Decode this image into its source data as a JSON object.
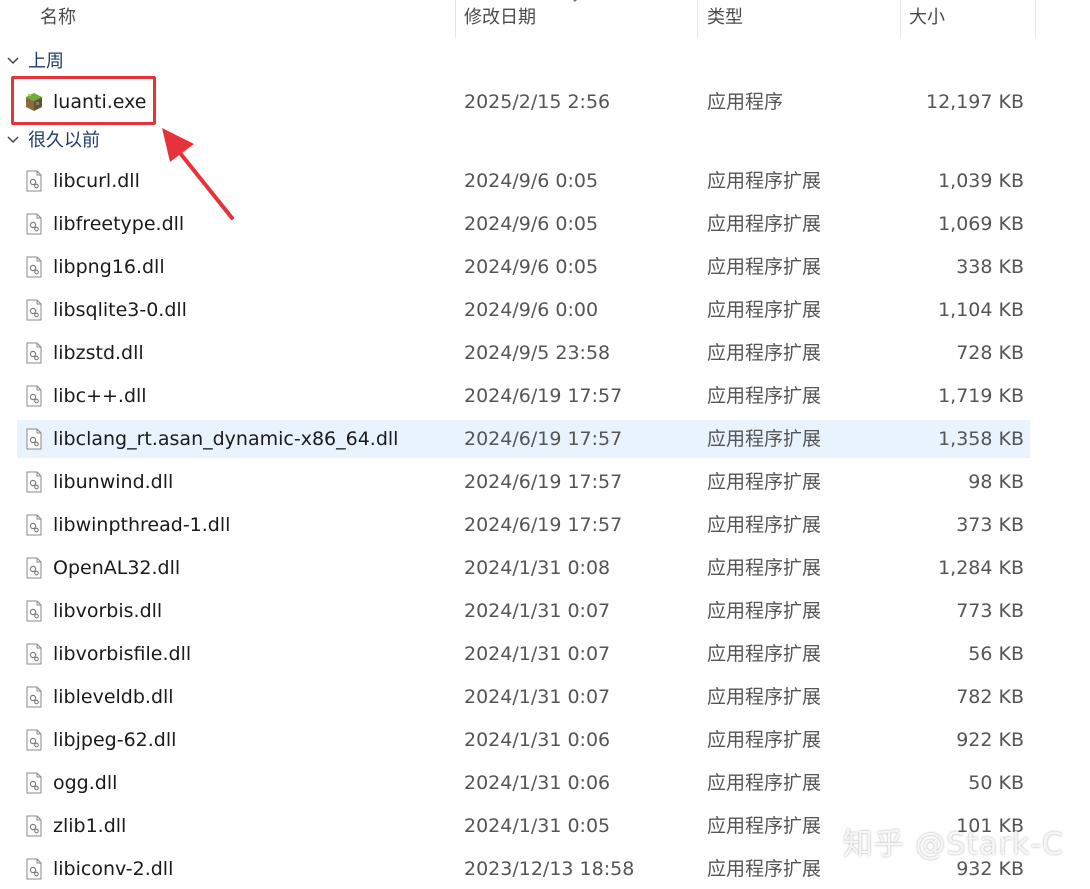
{
  "columns": {
    "name": "名称",
    "date": "修改日期",
    "type": "类型",
    "size": "大小"
  },
  "groups": [
    {
      "label": "上周",
      "files": [
        {
          "name": "luanti.exe",
          "date": "2025/2/15 2:56",
          "type": "应用程序",
          "size": "12,197 KB",
          "icon": "exe-app-icon"
        }
      ]
    },
    {
      "label": "很久以前",
      "files": [
        {
          "name": "libcurl.dll",
          "date": "2024/9/6 0:05",
          "type": "应用程序扩展",
          "size": "1,039 KB",
          "icon": "dll-file-icon"
        },
        {
          "name": "libfreetype.dll",
          "date": "2024/9/6 0:05",
          "type": "应用程序扩展",
          "size": "1,069 KB",
          "icon": "dll-file-icon"
        },
        {
          "name": "libpng16.dll",
          "date": "2024/9/6 0:05",
          "type": "应用程序扩展",
          "size": "338 KB",
          "icon": "dll-file-icon"
        },
        {
          "name": "libsqlite3-0.dll",
          "date": "2024/9/6 0:00",
          "type": "应用程序扩展",
          "size": "1,104 KB",
          "icon": "dll-file-icon"
        },
        {
          "name": "libzstd.dll",
          "date": "2024/9/5 23:58",
          "type": "应用程序扩展",
          "size": "728 KB",
          "icon": "dll-file-icon"
        },
        {
          "name": "libc++.dll",
          "date": "2024/6/19 17:57",
          "type": "应用程序扩展",
          "size": "1,719 KB",
          "icon": "dll-file-icon"
        },
        {
          "name": "libclang_rt.asan_dynamic-x86_64.dll",
          "date": "2024/6/19 17:57",
          "type": "应用程序扩展",
          "size": "1,358 KB",
          "icon": "dll-file-icon",
          "selected": true
        },
        {
          "name": "libunwind.dll",
          "date": "2024/6/19 17:57",
          "type": "应用程序扩展",
          "size": "98 KB",
          "icon": "dll-file-icon"
        },
        {
          "name": "libwinpthread-1.dll",
          "date": "2024/6/19 17:57",
          "type": "应用程序扩展",
          "size": "373 KB",
          "icon": "dll-file-icon"
        },
        {
          "name": "OpenAL32.dll",
          "date": "2024/1/31 0:08",
          "type": "应用程序扩展",
          "size": "1,284 KB",
          "icon": "dll-file-icon"
        },
        {
          "name": "libvorbis.dll",
          "date": "2024/1/31 0:07",
          "type": "应用程序扩展",
          "size": "773 KB",
          "icon": "dll-file-icon"
        },
        {
          "name": "libvorbisfile.dll",
          "date": "2024/1/31 0:07",
          "type": "应用程序扩展",
          "size": "56 KB",
          "icon": "dll-file-icon"
        },
        {
          "name": "libleveldb.dll",
          "date": "2024/1/31 0:07",
          "type": "应用程序扩展",
          "size": "782 KB",
          "icon": "dll-file-icon"
        },
        {
          "name": "libjpeg-62.dll",
          "date": "2024/1/31 0:06",
          "type": "应用程序扩展",
          "size": "922 KB",
          "icon": "dll-file-icon"
        },
        {
          "name": "ogg.dll",
          "date": "2024/1/31 0:06",
          "type": "应用程序扩展",
          "size": "50 KB",
          "icon": "dll-file-icon"
        },
        {
          "name": "zlib1.dll",
          "date": "2024/1/31 0:05",
          "type": "应用程序扩展",
          "size": "101 KB",
          "icon": "dll-file-icon"
        },
        {
          "name": "libiconv-2.dll",
          "date": "2023/12/13 18:58",
          "type": "应用程序扩展",
          "size": "932 KB",
          "icon": "dll-file-icon"
        }
      ]
    }
  ],
  "watermark": "知乎 @Stark-C",
  "colors": {
    "highlight": "#e6333a",
    "selected_row": "#e8f3fd",
    "group_label": "#1f3a6b"
  }
}
